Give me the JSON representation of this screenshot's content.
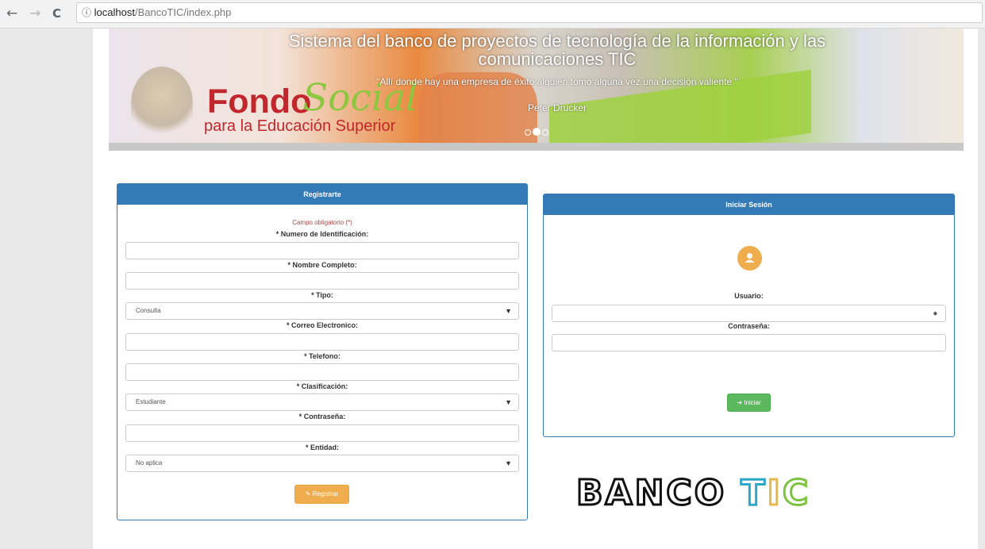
{
  "browser": {
    "back": "←",
    "forward": "→",
    "reload": "C",
    "info_icon": "ⓘ",
    "url_host": "localhost",
    "url_path": "/BancoTIC/index.php"
  },
  "banner": {
    "title": "Sistema del banco de proyectos de tecnología de la información y las comunicaciones TIC",
    "quote": "\"Allí donde hay una empresa de éxito alguien tomó alguna vez una decisión valiente.\"",
    "author": "Peter Drucker",
    "logo_fondo": "Fondo",
    "logo_social": "Social",
    "logo_edu": "para la Educación Superior",
    "slides": 3,
    "active_slide": 2
  },
  "register": {
    "heading": "Registrarte",
    "required_note": "Campo obligatorio (*)",
    "id_label": "* Numero de Identificación:",
    "name_label": "* Nombre Completo:",
    "type_label": "* Tipo:",
    "type_value": "Consulta",
    "email_label": "* Correo Electronico:",
    "phone_label": "* Telefono:",
    "class_label": "* Clasificación:",
    "class_value": "Estudiante",
    "password_label": "* Contraseña:",
    "entity_label": "* Entidad:",
    "entity_value": "No aplica",
    "submit": "Registrar"
  },
  "login": {
    "heading": "Iniciar Sesión",
    "user_label": "Usuario:",
    "password_label": "Contraseña:",
    "submit": "Iniciar"
  },
  "logo": {
    "banco": "BANCO",
    "t": "T",
    "i": "I",
    "c": "C"
  },
  "colors": {
    "primary": "#337ab7",
    "warning": "#f0ad4e",
    "success": "#5cb85c",
    "danger_text": "#a94442"
  }
}
